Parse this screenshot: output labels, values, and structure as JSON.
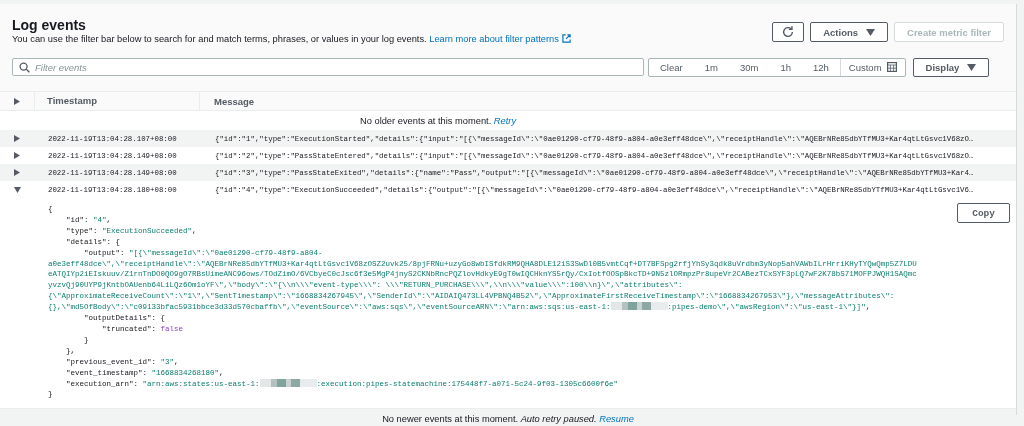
{
  "header": {
    "title": "Log events",
    "description": "You can use the filter bar below to search for and match terms, phrases, or values in your log events.",
    "link": "Learn more about filter patterns"
  },
  "header_buttons": [
    {
      "kind": "refresh"
    },
    {
      "kind": "dropdown",
      "label": "Actions",
      "disabled": false
    },
    {
      "kind": "text",
      "label": "Create metric filter",
      "disabled": true
    }
  ],
  "search": {
    "placeholder": "Filter events"
  },
  "time_range": [
    {
      "label": "Clear",
      "kind": "text"
    },
    {
      "label": "1m",
      "kind": "text"
    },
    {
      "label": "30m",
      "kind": "text"
    },
    {
      "label": "1h",
      "kind": "text"
    },
    {
      "label": "12h",
      "kind": "text"
    },
    {
      "label": "Custom",
      "kind": "calendar"
    }
  ],
  "display_button": "Display",
  "table": {
    "columns": [
      "Timestamp",
      "Message"
    ],
    "top_status": {
      "text": "No older events at this moment.",
      "link": "Retry"
    },
    "rows": [
      {
        "timestamp": "2022-11-19T13:04:28.107+08:00",
        "message": "{\"id\":\"1\",\"type\":\"ExecutionStarted\",\"details\":{\"input\":\"[{\\\"messageId\\\":\\\"0ae01290-cf79-48f9-a804-a0e3eff48dce\\\",\\\"receiptHandle\\\":\\\"AQEBrNRe85dbYTfMU3+Kar4qtLtGsvc1V68zO…",
        "expanded": false
      },
      {
        "timestamp": "2022-11-19T13:04:28.149+08:00",
        "message": "{\"id\":\"2\",\"type\":\"PassStateEntered\",\"details\":{\"input\":\"[{\\\"messageId\\\":\\\"0ae01290-cf79-48f9-a804-a0e3eff48dce\\\",\\\"receiptHandle\\\":\\\"AQEBrNRe85dbYTfMU3+Kar4qtLtGsvc1V68zO…",
        "expanded": false
      },
      {
        "timestamp": "2022-11-19T13:04:28.149+08:00",
        "message": "{\"id\":\"3\",\"type\":\"PassStateExited\",\"details\":{\"name\":\"Pass\",\"output\":\"[{\\\"messageId\\\":\\\"0ae01290-cf79-48f9-a804-a0e3eff48dce\\\",\\\"receiptHandle\\\":\\\"AQEBrNRe85dbYTfMU3+Kar4…",
        "expanded": false
      },
      {
        "timestamp": "2022-11-19T13:04:28.180+08:00",
        "message": "{\"id\":\"4\",\"type\":\"ExecutionSucceeded\",\"details\":{\"output\":\"[{\\\"messageId\\\":\\\"0ae01290-cf79-48f9-a804-a0e3eff48dce\\\",\\\"receiptHandle\\\":\\\"AQEBrNRe85dbYTfMU3+Kar4qtLtGsvc1V6…",
        "expanded": true
      }
    ],
    "detail": {
      "copy_button": "Copy",
      "lines": [
        [
          {
            "kind": "plain",
            "text": "{"
          }
        ],
        [
          {
            "kind": "plain",
            "text": "    \"id\": "
          },
          {
            "kind": "string",
            "text": "\"4\""
          },
          {
            "kind": "plain",
            "text": ","
          }
        ],
        [
          {
            "kind": "plain",
            "text": "    \"type\": "
          },
          {
            "kind": "string",
            "text": "\"ExecutionSucceeded\""
          },
          {
            "kind": "plain",
            "text": ","
          }
        ],
        [
          {
            "kind": "plain",
            "text": "    \"details\": {"
          }
        ],
        [
          {
            "kind": "plain",
            "text": "        \"output\": "
          },
          {
            "kind": "string",
            "text": "\"[{\\\"messageId\\\":\\\"0ae01290-cf79-48f9-a804-"
          }
        ],
        [
          {
            "kind": "string",
            "text": "a0e3eff48dce\\\",\\\"receiptHandle\\\":\\\"AQEBrNRe85dbYTfMU3+Kar4qtLtGsvc1V68zOSZ2uvk25/8pjFRNu+uzyGo8wbISfdkRM9QHA8DLE12iS3SwDl0B5vmtCqf+DT7BFSpg2rfjYhSy3qdk8uVrdbm3yNop5ahVAWbILrHrriKHyTYQwQmp5Z7LDU"
          }
        ],
        [
          {
            "kind": "string",
            "text": "eATQIYp2iEIskuuv/Z1rnTnDO0QO9gO7RBsUimeANC96ows/TOdZimO/6VCbyeC0cJsc6f3e5MgP4jnyS2CKNbRncPQZlovHdkyE9gT0wIQCHknYS5rQy/CxIotfOOSpBkcTD+9N5zlORmpzPr8upeVr2CABezTCxSYF3pLQ7wF2K78bS71MOFPJWQH1SAQmc"
          }
        ],
        [
          {
            "kind": "string",
            "text": "yvzvQj90UYP9jKntbOAUenb64LiLQz6Om1oYF\\\",\\\"body\\\":\\\"{\\\\n\\\\\\\"event-type\\\\\\\": \\\\\\\"RETURN_PURCHASE\\\\\\\",\\\\n\\\\\\\"value\\\\\\\":100\\\\n}\\\",\\\"attributes\\\":"
          }
        ],
        [
          {
            "kind": "string",
            "text": "{\\\"ApproximateReceiveCount\\\":\\\"1\\\",\\\"SentTimestamp\\\":\\\"1668834267945\\\",\\\"SenderId\\\":\\\"AIDAIQ473LL4VPBNQ4B52\\\",\\\"ApproximateFirstReceiveTimestamp\\\":\\\"1668834267953\\\"},\\\"messageAttributes\\\":"
          }
        ],
        [
          {
            "kind": "string",
            "text": "{},\\\"md5OfBody\\\":\\\"c09133bfac5931bbce3d33d570cbaffb\\\",\\\"eventSource\\\":\\\"aws:sqs\\\",\\\"eventSourceARN\\\":\\\"arn:aws:sqs:us-east-1:"
          },
          {
            "kind": "redacted"
          },
          {
            "kind": "string",
            "text": ":pipes-demo\\\",\\\"awsRegion\\\":\\\"us-east-1\\\"}]\""
          },
          {
            "kind": "plain",
            "text": ","
          }
        ],
        [
          {
            "kind": "plain",
            "text": "        \"outputDetails\": {"
          }
        ],
        [
          {
            "kind": "plain",
            "text": "            \"truncated\": "
          },
          {
            "kind": "boolean",
            "text": "false"
          }
        ],
        [
          {
            "kind": "plain",
            "text": "        }"
          }
        ],
        [
          {
            "kind": "plain",
            "text": "    },"
          }
        ],
        [
          {
            "kind": "plain",
            "text": "    \"previous_event_id\": "
          },
          {
            "kind": "string",
            "text": "\"3\""
          },
          {
            "kind": "plain",
            "text": ","
          }
        ],
        [
          {
            "kind": "plain",
            "text": "    \"event_timestamp\": "
          },
          {
            "kind": "string",
            "text": "\"1668834268180\""
          },
          {
            "kind": "plain",
            "text": ","
          }
        ],
        [
          {
            "kind": "plain",
            "text": "    \"execution_arn\": "
          },
          {
            "kind": "string",
            "text": "\"arn:aws:states:us-east-1:"
          },
          {
            "kind": "redacted"
          },
          {
            "kind": "string",
            "text": ":execution:pipes-statemachine:175448f7-a071-5c24-9f03-1305c6600f6e\""
          }
        ],
        [
          {
            "kind": "plain",
            "text": "}"
          }
        ]
      ]
    },
    "bottom_status": {
      "text": "No newer events at this moment.",
      "note": "Auto retry paused.",
      "link": "Resume"
    }
  }
}
